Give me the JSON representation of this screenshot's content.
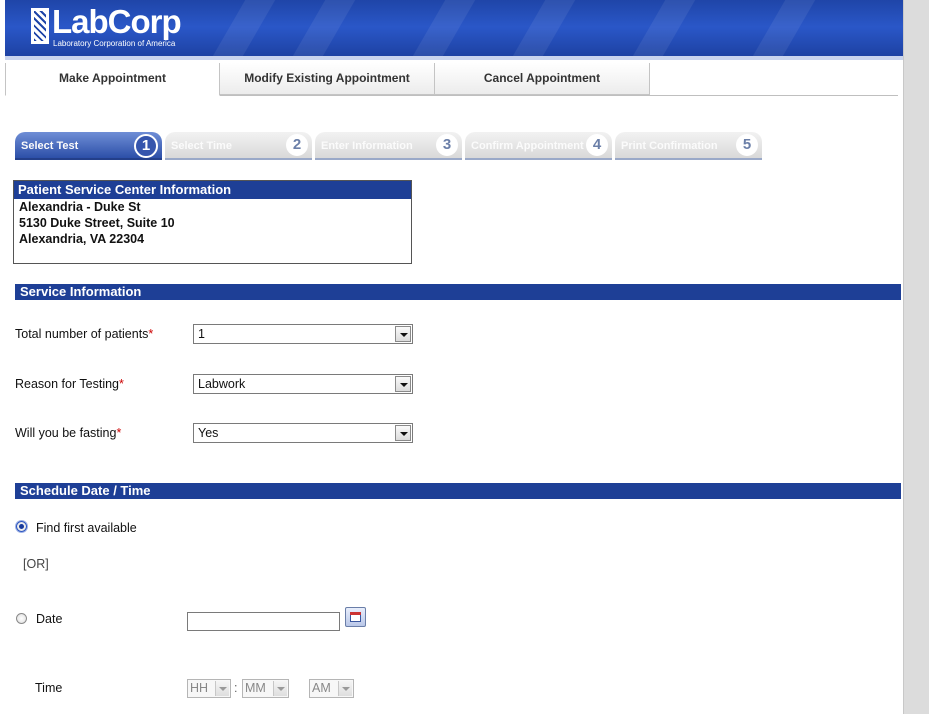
{
  "header": {
    "logo_text": "LabCorp",
    "logo_subtitle": "Laboratory Corporation of America"
  },
  "tabs": [
    {
      "label": "Make Appointment"
    },
    {
      "label": "Modify Existing Appointment"
    },
    {
      "label": "Cancel Appointment"
    }
  ],
  "steps": [
    {
      "label": "Select Test",
      "number": "1"
    },
    {
      "label": "Select Time",
      "number": "2"
    },
    {
      "label": "Enter Information",
      "number": "3"
    },
    {
      "label": "Confirm Appointment",
      "number": "4"
    },
    {
      "label": "Print Confirmation",
      "number": "5"
    }
  ],
  "psc": {
    "title": "Patient Service Center Information",
    "name": "Alexandria - Duke St",
    "street": "5130 Duke Street, Suite 10",
    "city": "Alexandria, VA 22304"
  },
  "service": {
    "title": "Service Information",
    "patients_label": "Total number of patients",
    "patients_value": "1",
    "reason_label": "Reason for Testing",
    "reason_value": "Labwork",
    "fasting_label": "Will you be fasting",
    "fasting_value": "Yes",
    "required_mark": "*"
  },
  "schedule": {
    "title": "Schedule Date / Time",
    "first_available_label": "Find first available",
    "or_text": "[OR]",
    "date_label": "Date",
    "date_value": "",
    "time_label": "Time",
    "hour_placeholder": "HH",
    "time_separator": ":",
    "minute_placeholder": "MM",
    "ampm_value": "AM"
  },
  "colors": {
    "header_blue": "#1f45a8",
    "section_blue": "#1e3f96",
    "required_red": "#cc0000"
  }
}
